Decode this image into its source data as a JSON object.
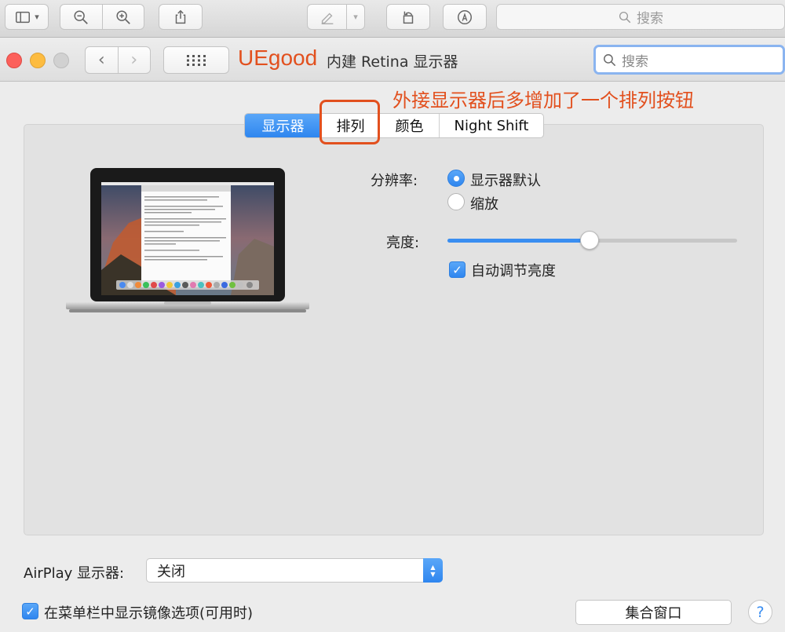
{
  "preview_toolbar": {
    "search_placeholder": "搜索"
  },
  "window": {
    "brand": "UEgood",
    "title": "内建 Retina 显示器",
    "search_placeholder": "搜索"
  },
  "annotation": "外接显示器后多增加了一个排列按钮",
  "tabs": [
    {
      "label": "显示器",
      "active": true
    },
    {
      "label": "排列",
      "active": false
    },
    {
      "label": "颜色",
      "active": false
    },
    {
      "label": "Night Shift",
      "active": false
    }
  ],
  "resolution": {
    "label": "分辨率:",
    "options": [
      {
        "label": "显示器默认",
        "selected": true
      },
      {
        "label": "缩放",
        "selected": false
      }
    ]
  },
  "brightness": {
    "label": "亮度:",
    "value": 0.49,
    "auto_label": "自动调节亮度",
    "auto_checked": true
  },
  "airplay": {
    "label": "AirPlay 显示器:",
    "value": "关闭"
  },
  "mirror_option": {
    "label": "在菜单栏中显示镜像选项(可用时)",
    "checked": true
  },
  "gather_windows_label": "集合窗口",
  "help_label": "?",
  "colors": {
    "accent": "#3a8ef1",
    "annotation": "#e2501e"
  }
}
